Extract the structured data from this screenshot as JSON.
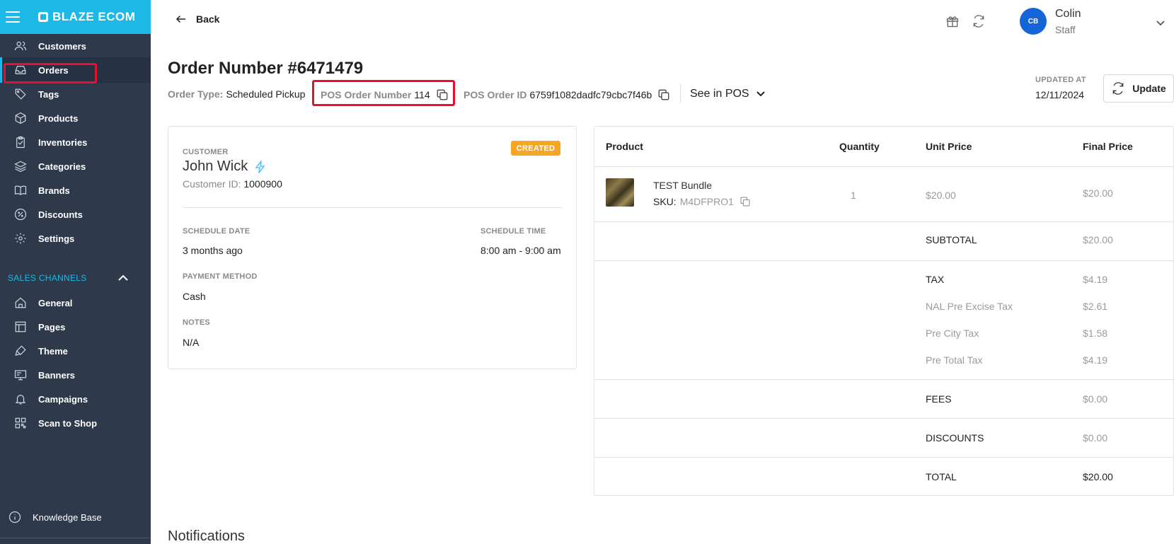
{
  "brand": {
    "name": "BLAZE ECOM"
  },
  "sidebar": {
    "items": [
      {
        "label": "Customers",
        "icon": "users-icon"
      },
      {
        "label": "Orders",
        "icon": "inbox-icon"
      },
      {
        "label": "Tags",
        "icon": "tag-icon"
      },
      {
        "label": "Products",
        "icon": "box-icon"
      },
      {
        "label": "Inventories",
        "icon": "clipboard-icon"
      },
      {
        "label": "Categories",
        "icon": "layers-icon"
      },
      {
        "label": "Brands",
        "icon": "book-icon"
      },
      {
        "label": "Discounts",
        "icon": "percent-icon"
      },
      {
        "label": "Settings",
        "icon": "gear-icon"
      }
    ],
    "sales_channels_label": "SALES CHANNELS",
    "channel_items": [
      {
        "label": "General",
        "icon": "home-icon"
      },
      {
        "label": "Pages",
        "icon": "pages-icon"
      },
      {
        "label": "Theme",
        "icon": "brush-icon"
      },
      {
        "label": "Banners",
        "icon": "monitor-icon"
      },
      {
        "label": "Campaigns",
        "icon": "bell-icon"
      },
      {
        "label": "Scan to Shop",
        "icon": "qr-icon"
      }
    ],
    "knowledge_base": "Knowledge Base"
  },
  "topbar": {
    "back_label": "Back",
    "user": {
      "initials": "CB",
      "name": "Colin",
      "role": "Staff"
    }
  },
  "order": {
    "title": "Order Number #6471479",
    "order_type_label": "Order Type:",
    "order_type": "Scheduled Pickup",
    "pos_number_label": "POS Order Number",
    "pos_number": "114",
    "pos_id_label": "POS Order ID",
    "pos_id": "6759f1082dadfc79cbc7f46b",
    "see_in_pos": "See in POS",
    "updated_label": "UPDATED AT",
    "updated_value": "12/11/2024",
    "update_button": "Update"
  },
  "customer_card": {
    "customer_label": "CUSTOMER",
    "name": "John Wick",
    "customer_id_label": "Customer ID:",
    "customer_id": "1000900",
    "status": "CREATED",
    "schedule_date_label": "SCHEDULE DATE",
    "schedule_date": "3 months ago",
    "schedule_time_label": "SCHEDULE TIME",
    "schedule_time": "8:00 am - 9:00 am",
    "payment_label": "PAYMENT METHOD",
    "payment": "Cash",
    "notes_label": "NOTES",
    "notes": "N/A"
  },
  "products_table": {
    "headers": {
      "product": "Product",
      "quantity": "Quantity",
      "unit_price": "Unit Price",
      "final_price": "Final Price"
    },
    "items": [
      {
        "name": "TEST Bundle",
        "sku_label": "SKU:",
        "sku": "M4DFPRO1",
        "quantity": "1",
        "unit_price": "$20.00",
        "final_price": "$20.00"
      }
    ],
    "summary": {
      "subtotal_label": "SUBTOTAL",
      "subtotal": "$20.00",
      "tax_label": "TAX",
      "tax": "$4.19",
      "nal_label": "NAL Pre Excise Tax",
      "nal": "$2.61",
      "city_label": "Pre City Tax",
      "city": "$1.58",
      "pretotal_label": "Pre Total Tax",
      "pretotal": "$4.19",
      "fees_label": "FEES",
      "fees": "$0.00",
      "discounts_label": "DISCOUNTS",
      "discounts": "$0.00",
      "total_label": "TOTAL",
      "total": "$20.00"
    }
  },
  "notifications_heading": "Notifications",
  "colors": {
    "sidebar": "#2e3a4c",
    "brand": "#1db8e6",
    "highlight": "#e8102d",
    "badge": "#f5a623",
    "avatar": "#1565d8"
  }
}
